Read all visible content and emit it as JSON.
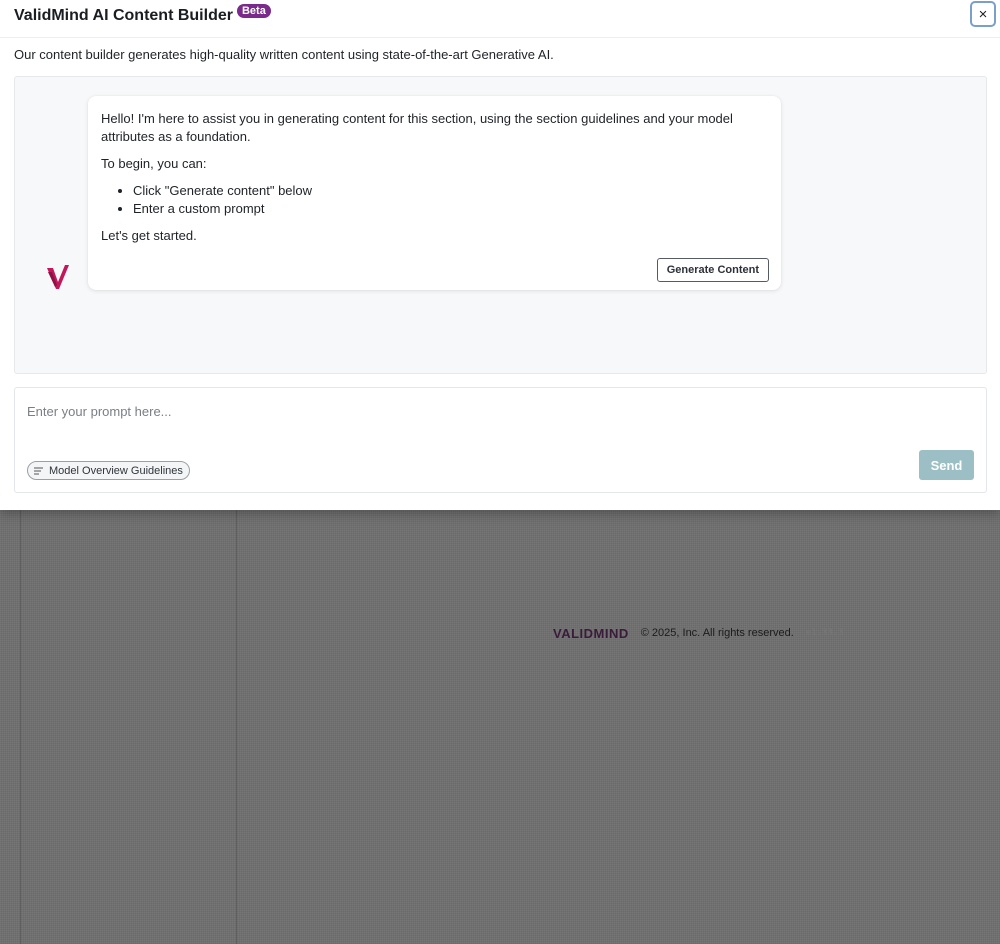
{
  "modal": {
    "title": "ValidMind AI Content Builder",
    "badge": "Beta",
    "close_glyph": "×",
    "description": "Our content builder generates high-quality written content using state-of-the-art Generative AI."
  },
  "chat": {
    "assistant_icon": "validmind-v-logo-icon",
    "message": {
      "intro": "Hello! I'm here to assist you in generating content for this section, using the section guidelines and your model attributes as a foundation.",
      "lead": "To begin, you can:",
      "options": [
        "Click \"Generate content\" below",
        "Enter a custom prompt"
      ],
      "closing": "Let's get started."
    },
    "generate_button_label": "Generate Content"
  },
  "prompt": {
    "placeholder": "Enter your prompt here...",
    "value": "",
    "guidelines_chip_label": "Model Overview Guidelines",
    "guidelines_icon": "lines-icon",
    "send_label": "Send"
  },
  "background_footer": {
    "logo_text": "VALIDMIND",
    "copyright": "© 2025, Inc. All rights reserved.",
    "version": "v1.33.3"
  },
  "colors": {
    "brand_magenta": "#c2185b",
    "beta_badge": "#7a2a8a",
    "send_button": "#9bbfc4",
    "overlay": "#707070"
  }
}
